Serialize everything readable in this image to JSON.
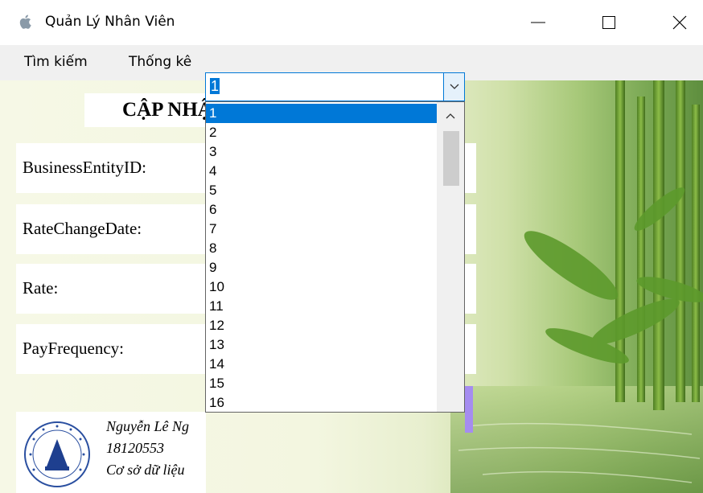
{
  "window": {
    "title": "Quản Lý Nhân Viên",
    "controls": {
      "minimize": "minimize",
      "maximize": "maximize",
      "close": "close"
    }
  },
  "menu": {
    "items": [
      {
        "label": "Tìm kiếm"
      },
      {
        "label": "Thống kê"
      }
    ]
  },
  "form": {
    "heading": "CẬP NHẬT LƯƠNG NHÂN VIÊN",
    "fields": [
      {
        "label": "BusinessEntityID:"
      },
      {
        "label": "RateChangeDate:"
      },
      {
        "label": "Rate:"
      },
      {
        "label": "PayFrequency:"
      }
    ],
    "combo_value": "1",
    "dropdown_options": [
      "1",
      "2",
      "3",
      "4",
      "5",
      "6",
      "7",
      "8",
      "9",
      "10",
      "11",
      "12",
      "13",
      "14",
      "15",
      "16"
    ]
  },
  "credits": {
    "name": "Nguyễn Lê Ng",
    "student_id": "18120553",
    "course": "Cơ sở dữ liệu"
  },
  "colors": {
    "accent": "#0078d7",
    "menu_bg": "#f0f0f0",
    "purple_button": "#a58cf0"
  }
}
